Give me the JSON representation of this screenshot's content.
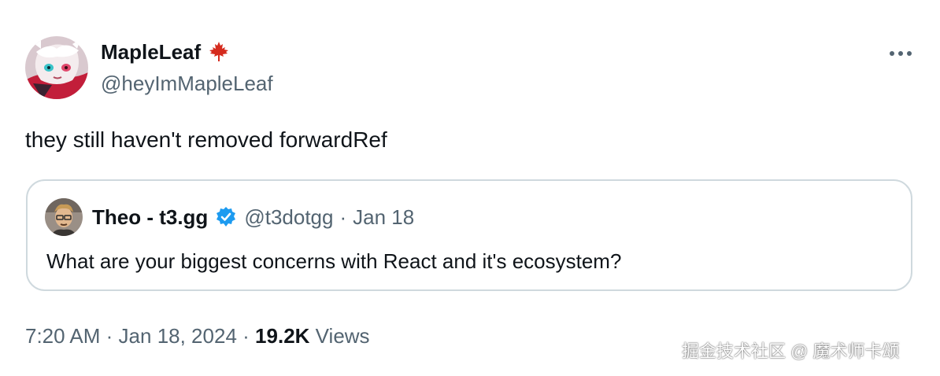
{
  "tweet": {
    "author": {
      "display_name": "MapleLeaf",
      "handle": "@heyImMapleLeaf",
      "flag_icon": "maple-leaf-icon"
    },
    "text": "they still haven't removed forwardRef",
    "quoted": {
      "display_name": "Theo - t3.gg",
      "handle": "@t3dotgg",
      "separator": "·",
      "date": "Jan 18",
      "text": "What are your biggest concerns with React and it's ecosystem?",
      "verified_color": "#1d9bf0"
    },
    "meta": {
      "time": "7:20 AM",
      "separator": "·",
      "date": "Jan 18, 2024",
      "separator2": "·",
      "views_count": "19.2K",
      "views_label": "Views"
    }
  },
  "watermark": "掘金技术社区 @ 魔术师卡颂",
  "colors": {
    "text_primary": "#0f1419",
    "text_secondary": "#536471",
    "border": "#cfd9de",
    "verified": "#1d9bf0",
    "maple": "#d52b1e"
  }
}
